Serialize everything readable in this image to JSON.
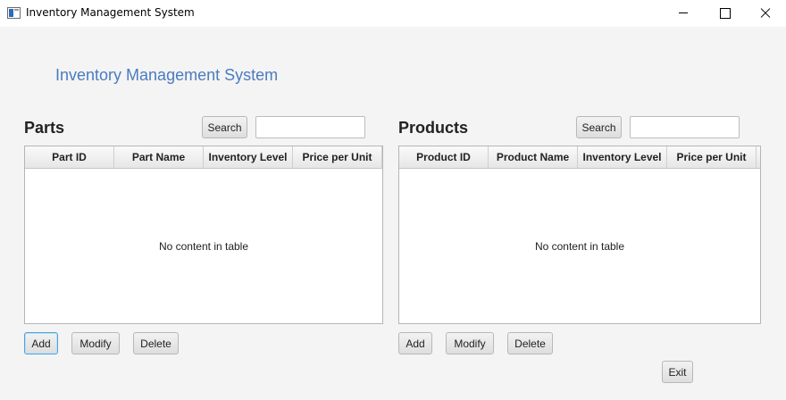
{
  "window": {
    "title": "Inventory Management System"
  },
  "heading": "Inventory Management System",
  "parts": {
    "title": "Parts",
    "search_label": "Search",
    "search_value": "",
    "columns": [
      "Part ID",
      "Part Name",
      "Inventory Level",
      "Price per Unit"
    ],
    "empty_message": "No content in table",
    "add_label": "Add",
    "modify_label": "Modify",
    "delete_label": "Delete"
  },
  "products": {
    "title": "Products",
    "search_label": "Search",
    "search_value": "",
    "columns": [
      "Product ID",
      "Product Name",
      "Inventory Level",
      "Price per Unit"
    ],
    "empty_message": "No content in table",
    "add_label": "Add",
    "modify_label": "Modify",
    "delete_label": "Delete"
  },
  "exit_label": "Exit",
  "colors": {
    "heading": "#4a7cc0",
    "focus": "#4fa3d9"
  }
}
